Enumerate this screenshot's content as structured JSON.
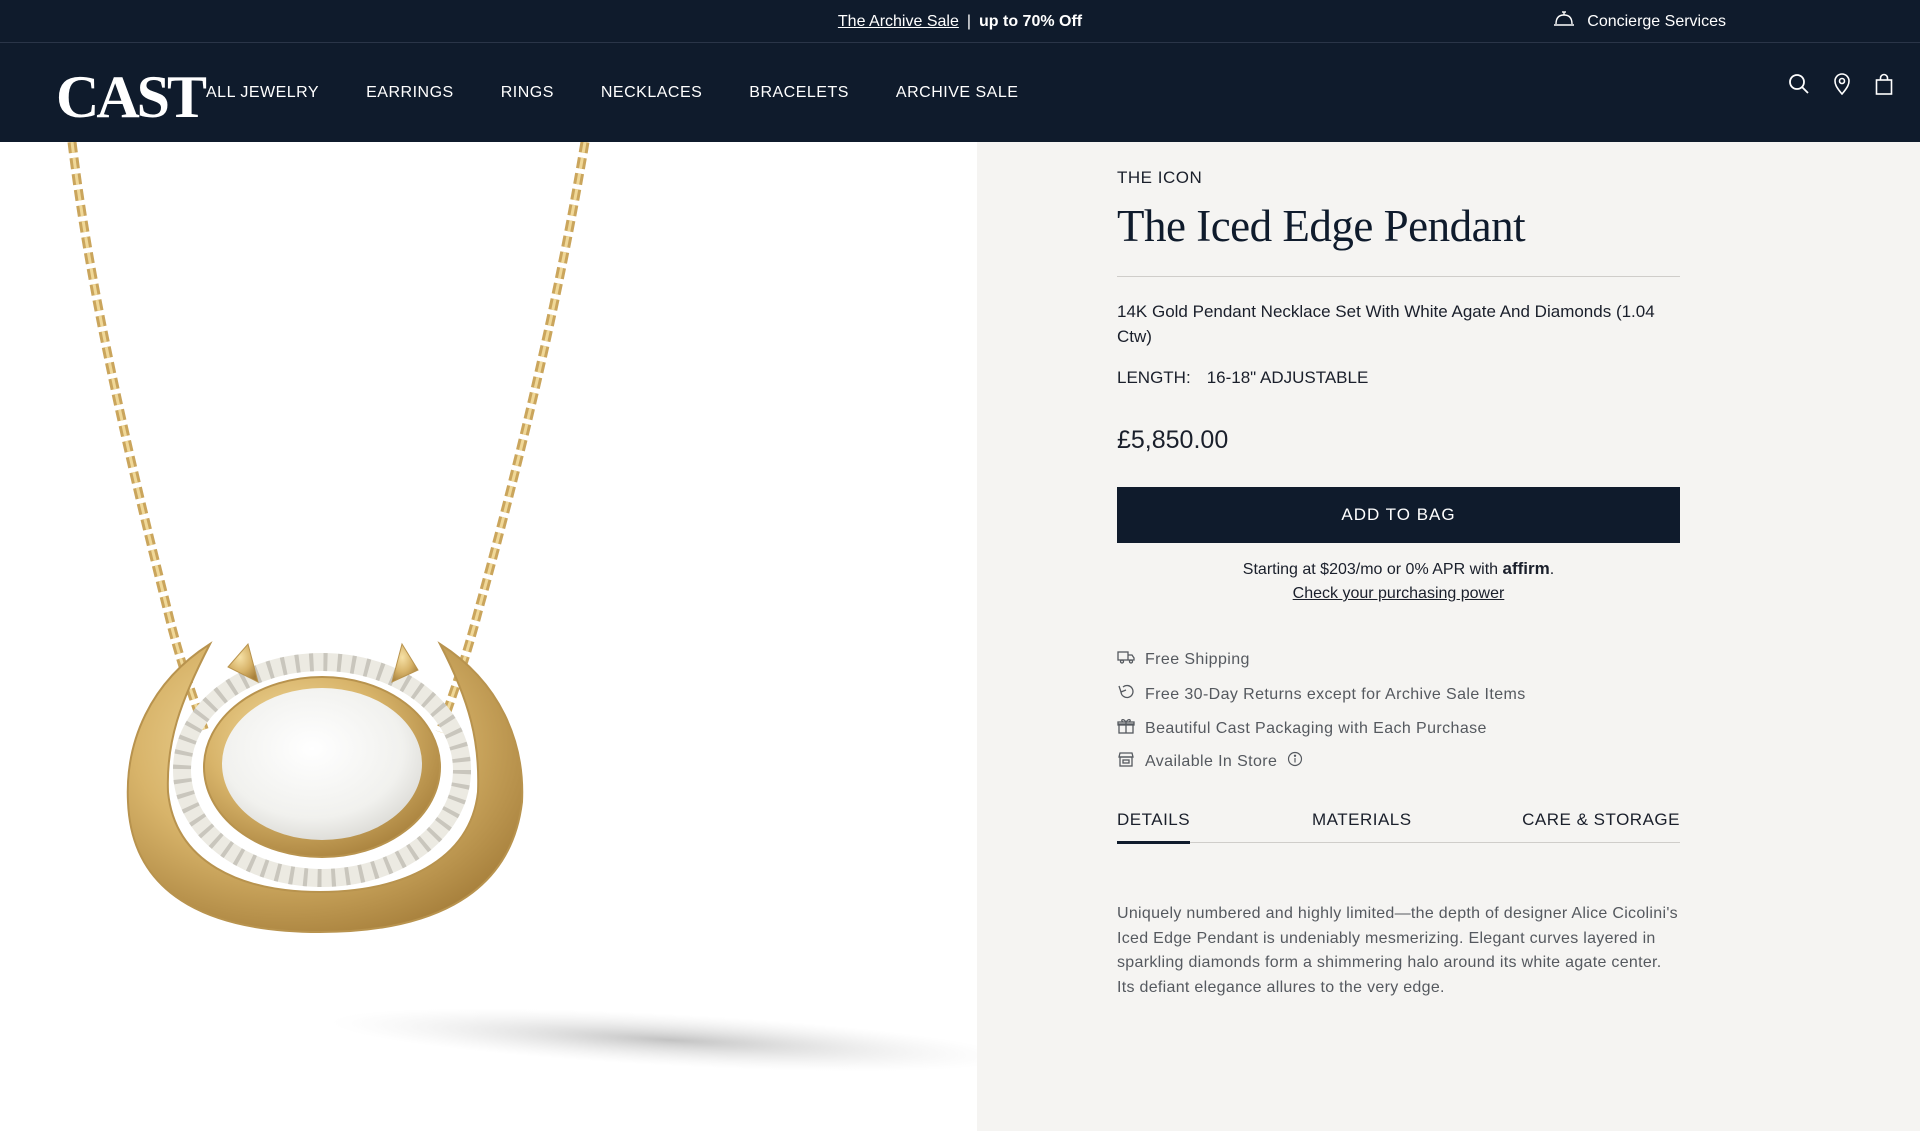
{
  "promo": {
    "link_text": "The Archive Sale",
    "separator": "|",
    "offer": "up to 70% Off"
  },
  "concierge": {
    "icon": "concierge-bell-icon",
    "label": "Concierge Services"
  },
  "nav": {
    "logo": "CAST",
    "items": [
      "ALL JEWELRY",
      "EARRINGS",
      "RINGS",
      "NECKLACES",
      "BRACELETS",
      "ARCHIVE SALE"
    ],
    "icons": [
      "search-icon",
      "location-pin-icon",
      "shopping-bag-icon"
    ]
  },
  "product": {
    "eyebrow": "THE ICON",
    "title": "The Iced Edge Pendant",
    "description": "14K Gold Pendant Necklace Set With White Agate And Diamonds (1.04 Ctw)",
    "length_label": "LENGTH:",
    "length_value": "16-18\" ADJUSTABLE",
    "price": "£5,850.00",
    "add_to_bag": "ADD TO BAG",
    "affirm_prefix": "Starting at $203/mo or 0% APR with",
    "affirm_brand": "affirm",
    "affirm_suffix": ".",
    "affirm_link": "Check your purchasing power"
  },
  "perks": [
    {
      "icon": "truck-icon",
      "label": "Free Shipping"
    },
    {
      "icon": "return-arrow-icon",
      "label": "Free 30-Day Returns except for Archive Sale Items"
    },
    {
      "icon": "gift-icon",
      "label": "Beautiful Cast Packaging with Each Purchase"
    },
    {
      "icon": "store-icon",
      "label": "Available In Store"
    }
  ],
  "tabs": {
    "items": [
      "DETAILS",
      "MATERIALS",
      "CARE & STORAGE"
    ],
    "active": "DETAILS"
  },
  "details_text": "Uniquely numbered and highly limited—the depth of designer Alice Cicolini's Iced Edge Pendant is undeniably mesmerizing. Elegant curves layered in sparkling diamonds form a shimmering halo around its white agate center. Its defiant elegance allures to the very edge.",
  "colors": {
    "navy": "#0f1b2c",
    "panel_bg": "#f5f4f2",
    "gold": "#d8b46a",
    "agate": "#f4f4f2"
  }
}
